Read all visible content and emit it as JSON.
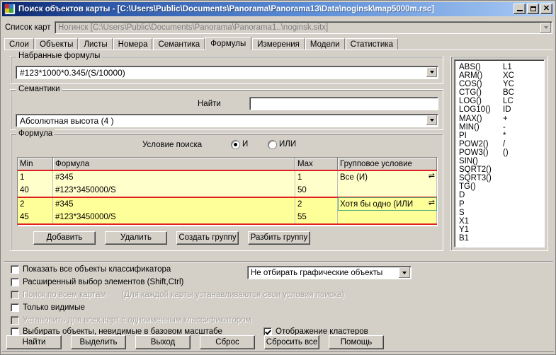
{
  "window": {
    "title": "Поиск объектов карты - [C:\\Users\\Public\\Documents\\Panorama\\Panorama13\\Data\\noginsk\\map5000m.rsc]",
    "icon": "map-globe-icon",
    "minimize_label": "_",
    "maximize_label": "□",
    "close_label": "✕",
    "accent_titlebar": "#0a246a",
    "face_color": "#d4d0c8"
  },
  "maps": {
    "label": "Список карт",
    "value": "Ногинск [C:\\Users\\Public\\Documents\\Panorama\\Panorama1..\\noginsk.sitx]"
  },
  "tabs": [
    {
      "label": "Слои",
      "active": false
    },
    {
      "label": "Объекты",
      "active": false
    },
    {
      "label": "Листы",
      "active": false
    },
    {
      "label": "Номера",
      "active": false
    },
    {
      "label": "Семантика",
      "active": false
    },
    {
      "label": "Формулы",
      "active": true
    },
    {
      "label": "Измерения",
      "active": false
    },
    {
      "label": "Модели",
      "active": false
    },
    {
      "label": "Статистика",
      "active": false
    }
  ],
  "typed_formulas": {
    "legend": "Набранные формулы",
    "value": "#123*1000*0.345/(S/10000)"
  },
  "semantics": {
    "legend": "Семантики",
    "find_label": "Найти",
    "find_value": "",
    "find_placeholder": "",
    "selected": "Абсолютная высота (4 )"
  },
  "formula": {
    "legend": "Формула",
    "condition_label": "Условие поиска",
    "radio_and": "И",
    "radio_or": "ИЛИ",
    "radio_selected": "И",
    "columns": [
      "Min",
      "Формула",
      "Max",
      "Групповое условие"
    ],
    "rows": [
      {
        "min": "1",
        "formula": "#345",
        "max": "1",
        "group": "Все (И)",
        "group_arrow": "⇌",
        "shade": "g1",
        "grp_start": true,
        "grp_end": false,
        "selected": false
      },
      {
        "min": "40",
        "formula": "#123*3450000/S",
        "max": "50",
        "group": "",
        "group_arrow": "",
        "shade": "g1",
        "grp_start": false,
        "grp_end": true,
        "selected": false
      },
      {
        "min": "2",
        "formula": "#345",
        "max": "2",
        "group": "Хотя бы одно (ИЛИ",
        "group_arrow": "⇌",
        "shade": "g2",
        "grp_start": true,
        "grp_end": false,
        "selected": true
      },
      {
        "min": "45",
        "formula": "#123*3450000/S",
        "max": "55",
        "group": "",
        "group_arrow": "",
        "shade": "g2",
        "grp_start": false,
        "grp_end": true,
        "selected": false
      }
    ],
    "buttons": [
      "Добавить",
      "Удалить",
      "Создать группу",
      "Разбить группу"
    ]
  },
  "functions": {
    "rows": [
      {
        "fn": "ABS()",
        "op": "L1"
      },
      {
        "fn": "ARM()",
        "op": "XC"
      },
      {
        "fn": "COS()",
        "op": "YC"
      },
      {
        "fn": "CTG()",
        "op": "BC"
      },
      {
        "fn": "LOG()",
        "op": "LC"
      },
      {
        "fn": "LOG10()",
        "op": "ID"
      },
      {
        "fn": "MAX()",
        "op": "+"
      },
      {
        "fn": "MIN()",
        "op": "-"
      },
      {
        "fn": "PI",
        "op": "*"
      },
      {
        "fn": "POW2()",
        "op": "/"
      },
      {
        "fn": "POW3()",
        "op": "()"
      },
      {
        "fn": "SIN()",
        "op": ""
      },
      {
        "fn": "SQRT2()",
        "op": ""
      },
      {
        "fn": "SQRT3()",
        "op": ""
      },
      {
        "fn": "TG()",
        "op": ""
      },
      {
        "fn": "D",
        "op": ""
      },
      {
        "fn": "P",
        "op": ""
      },
      {
        "fn": "S",
        "op": ""
      },
      {
        "fn": "X1",
        "op": ""
      },
      {
        "fn": "Y1",
        "op": ""
      },
      {
        "fn": "B1",
        "op": ""
      }
    ]
  },
  "options": {
    "show_all_classifier": {
      "label": "Показать все объекты классификатора",
      "checked": false,
      "disabled": false
    },
    "extended_select": {
      "label": "Расширенный выбор элементов (Shift,Ctrl)",
      "checked": false,
      "disabled": false
    },
    "search_all_maps": {
      "label": "Поиск по всем картам",
      "hint": "(Для каждой карты устанавливаются свои условия поиска)",
      "checked": false,
      "disabled": true
    },
    "only_visible": {
      "label": "Только видимые",
      "checked": false,
      "disabled": false
    },
    "apply_all_same": {
      "label": "Установить для всех карт с одноименным классификатором",
      "checked": false,
      "disabled": true
    },
    "select_invisible": {
      "label": "Выбирать объекты, невидимые в базовом масштабе",
      "checked": false,
      "disabled": false
    },
    "show_clusters": {
      "label": "Отображение кластеров",
      "checked": true,
      "disabled": false
    },
    "graphic_objects_combo": "Не отбирать графические объекты"
  },
  "bottom_buttons": [
    "Найти",
    "Выделить",
    "Выход",
    "Сброс",
    "Сбросить все",
    "Помощь"
  ]
}
